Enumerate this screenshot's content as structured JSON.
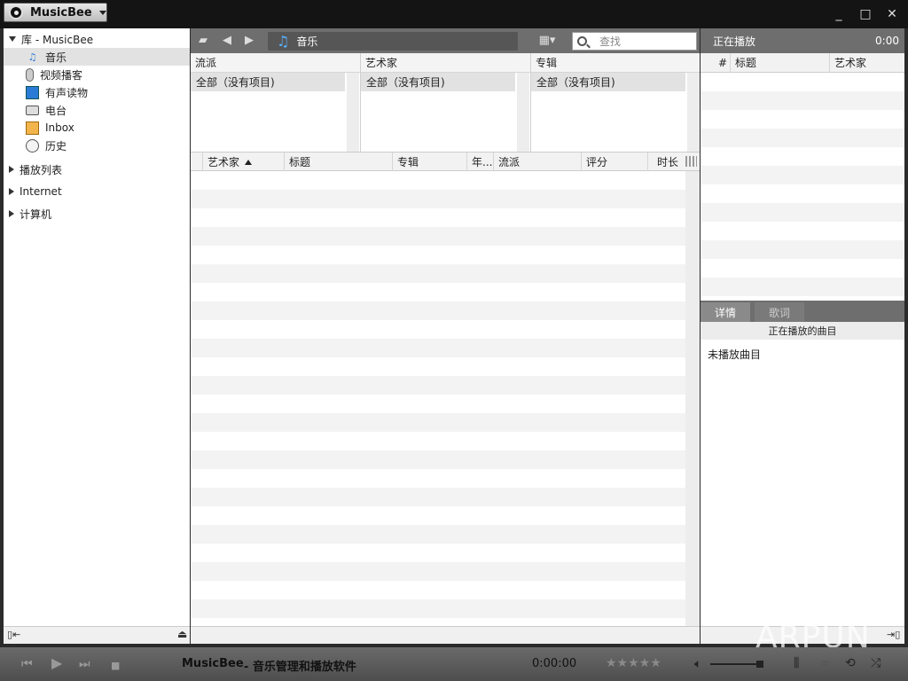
{
  "titlebar": {
    "app_name": "MusicBee",
    "minimize": "_",
    "maximize": "□",
    "close": "✕"
  },
  "left": {
    "library_label": "库 - MusicBee",
    "library_items": [
      {
        "label": "音乐",
        "icon": "music-note-icon",
        "selected": true
      },
      {
        "label": "视频播客",
        "icon": "microphone-icon",
        "selected": false
      },
      {
        "label": "有声读物",
        "icon": "audiobook-icon",
        "selected": false
      },
      {
        "label": "电台",
        "icon": "radio-icon",
        "selected": false
      },
      {
        "label": "Inbox",
        "icon": "inbox-icon",
        "selected": false
      },
      {
        "label": "历史",
        "icon": "history-icon",
        "selected": false
      }
    ],
    "sections": [
      "播放列表",
      "Internet",
      "计算机"
    ]
  },
  "toolbar": {
    "breadcrumb": "音乐",
    "search_placeholder": "查找"
  },
  "filters": [
    {
      "header": "流派",
      "item": "全部（没有项目)"
    },
    {
      "header": "艺术家",
      "item": "全部（没有项目)"
    },
    {
      "header": "专辑",
      "item": "全部（没有项目)"
    }
  ],
  "columns": [
    "艺术家",
    "标题",
    "专辑",
    "年...",
    "流派",
    "评分",
    "时长"
  ],
  "now_playing": {
    "header": "正在播放",
    "time": "0:00",
    "columns": [
      "#",
      "标题",
      "艺术家"
    ],
    "tabs": [
      "详情",
      "歌词"
    ],
    "sub_header": "正在播放的曲目",
    "empty_text": "未播放曲目"
  },
  "player": {
    "title": "MusicBee",
    "subtitle": "- 音乐管理和播放软件",
    "time": "0:00:00",
    "rating_stars": "★★★★★",
    "rating": 0,
    "volume": 0.87
  },
  "watermark": "ARPUN",
  "colors": {
    "accent": "#2a7bd6",
    "chrome": "#6e6e6e",
    "titlebar": "#141414"
  }
}
